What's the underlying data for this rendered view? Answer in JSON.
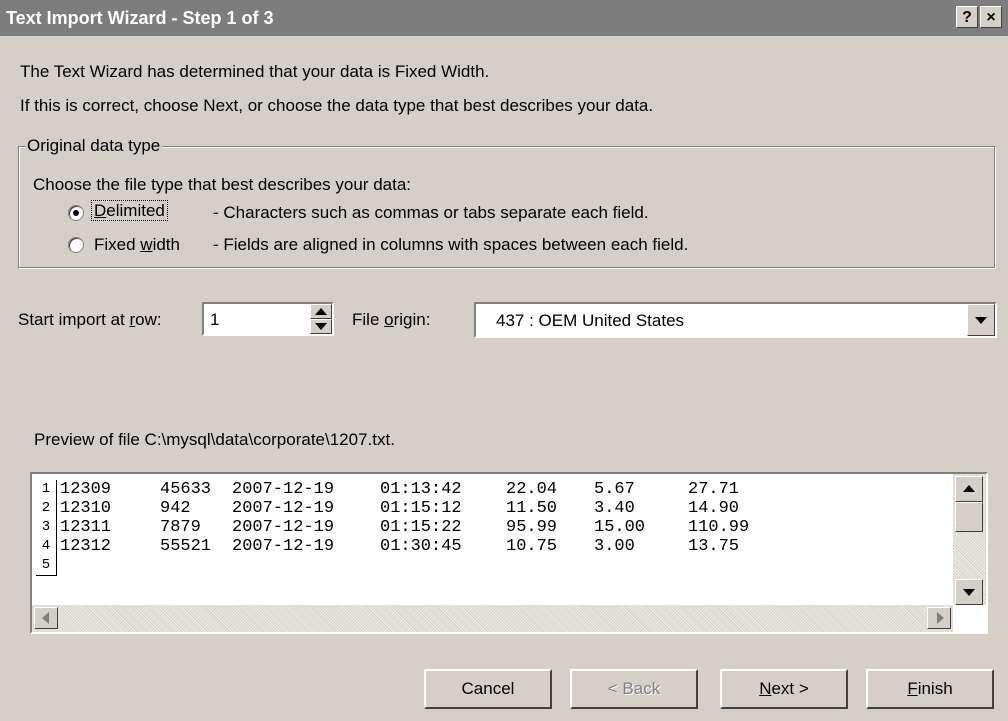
{
  "window": {
    "title": "Text Import Wizard - Step 1 of 3",
    "help_label": "?",
    "close_label": "×"
  },
  "intro": {
    "line1": "The Text Wizard has determined that your data is Fixed Width.",
    "line2": "If this is correct, choose Next, or choose the data type that best describes your data."
  },
  "data_type": {
    "group_label": "Original data type",
    "prompt": "Choose the file type that best describes your data:",
    "options": [
      {
        "label": "Delimited",
        "description": "- Characters such as commas or tabs separate each field.",
        "selected": true
      },
      {
        "label": "Fixed width",
        "description": "- Fields are aligned in columns with spaces between each field.",
        "selected": false
      }
    ]
  },
  "start_row": {
    "label": "Start import at row:",
    "value": "1"
  },
  "file_origin": {
    "label": "File origin:",
    "value": "437 : OEM United States"
  },
  "preview": {
    "label": "Preview of file C:\\mysql\\data\\corporate\\1207.txt.",
    "row_numbers": [
      "1",
      "2",
      "3",
      "4",
      "5"
    ],
    "rows": [
      [
        "12309",
        "45633",
        "2007-12-19",
        "01:13:42",
        "22.04",
        "5.67",
        "27.71"
      ],
      [
        "12310",
        "942",
        "2007-12-19",
        "01:15:12",
        "11.50",
        "3.40",
        "14.90"
      ],
      [
        "12311",
        "7879",
        "2007-12-19",
        "01:15:22",
        "95.99",
        "15.00",
        "110.99"
      ],
      [
        "12312",
        "55521",
        "2007-12-19",
        "01:30:45",
        "10.75",
        "3.00",
        "13.75"
      ]
    ]
  },
  "buttons": {
    "cancel": "Cancel",
    "back": "< Back",
    "next": "Next >",
    "finish": "Finish"
  }
}
